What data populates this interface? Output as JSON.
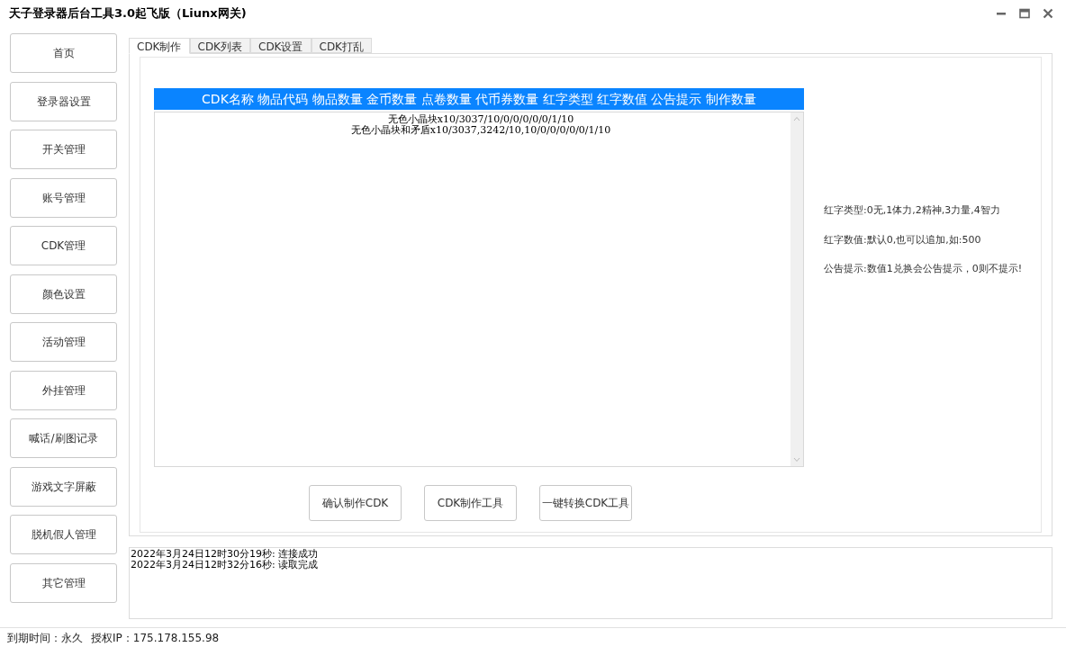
{
  "window": {
    "title": "天子登录器后台工具3.0起飞版（Liunx网关)"
  },
  "sidebar": {
    "items": [
      {
        "label": "首页"
      },
      {
        "label": "登录器设置"
      },
      {
        "label": "开关管理"
      },
      {
        "label": "账号管理"
      },
      {
        "label": "CDK管理"
      },
      {
        "label": "颜色设置"
      },
      {
        "label": "活动管理"
      },
      {
        "label": "外挂管理"
      },
      {
        "label": "喊话/刷图记录"
      },
      {
        "label": "游戏文字屏蔽"
      },
      {
        "label": "脱机假人管理"
      },
      {
        "label": "其它管理"
      }
    ]
  },
  "tabs": [
    {
      "label": "CDK制作",
      "selected": true
    },
    {
      "label": "CDK列表",
      "selected": false
    },
    {
      "label": "CDK设置",
      "selected": false
    },
    {
      "label": "CDK打乱",
      "selected": false
    }
  ],
  "cdk_list": {
    "header": "CDK名称 物品代码 物品数量 金币数量 点卷数量 代币券数量 红字类型 红字数值 公告提示 制作数量",
    "rows": [
      "无色小晶块x10/3037/10/0/0/0/0/0/1/10",
      "无色小晶块和矛盾x10/3037,3242/10,10/0/0/0/0/0/1/10"
    ]
  },
  "hints": [
    "红字类型:0无,1体力,2精神,3力量,4智力",
    "红字数值:默认0,也可以追加,如:500",
    "公告提示:数值1兑换会公告提示，0则不提示!"
  ],
  "buttons": [
    "确认制作CDK",
    "CDK制作工具",
    "一键转换CDK工具"
  ],
  "log": [
    "2022年3月24日12时30分19秒: 连接成功",
    "2022年3月24日12时32分16秒: 读取完成"
  ],
  "status_bar": [
    "到期时间：永久",
    "授权IP：175.178.155.98"
  ]
}
